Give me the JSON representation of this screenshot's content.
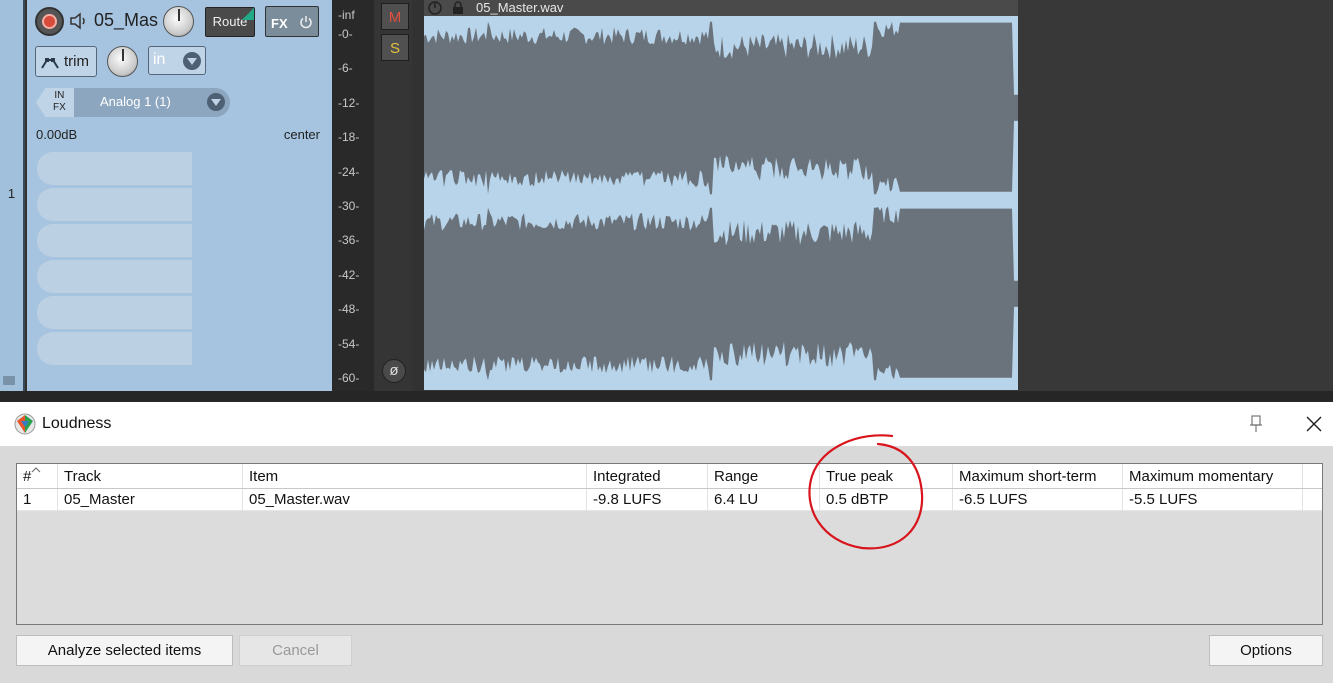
{
  "track": {
    "number": "1",
    "name": "05_Mas",
    "route_label": "Route",
    "fx_label": "FX",
    "trim_label": "trim",
    "input_mode": "in",
    "input_fx_label": "IN\nFX",
    "input_source": "Analog 1 (1)",
    "volume_readout": "0.00dB",
    "pan_readout": "center",
    "mute_label": "M",
    "solo_label": "S",
    "phase_label": "ø",
    "color": "#a6c4e0"
  },
  "meter": {
    "scale": [
      "-inf",
      "-0-",
      "-6-",
      "-12-",
      "-18-",
      "-24-",
      "-30-",
      "-36-",
      "-42-",
      "-48-",
      "-54-",
      "-60-"
    ]
  },
  "media_item": {
    "name": "05_Master.wav",
    "wave_color": "#6a737b",
    "background": "#b8d4ea"
  },
  "loudness_window": {
    "title": "Loudness",
    "columns": [
      "#",
      "Track",
      "Item",
      "Integrated",
      "Range",
      "True peak",
      "Maximum short-term",
      "Maximum momentary"
    ],
    "rows": [
      [
        "1",
        "05_Master",
        "05_Master.wav",
        "-9.8 LUFS",
        "6.4 LU",
        "0.5 dBTP",
        "-6.5 LUFS",
        "-5.5 LUFS"
      ]
    ],
    "buttons": {
      "analyze": "Analyze selected items",
      "cancel": "Cancel",
      "options": "Options"
    },
    "annotation_color": "#d8141c"
  }
}
